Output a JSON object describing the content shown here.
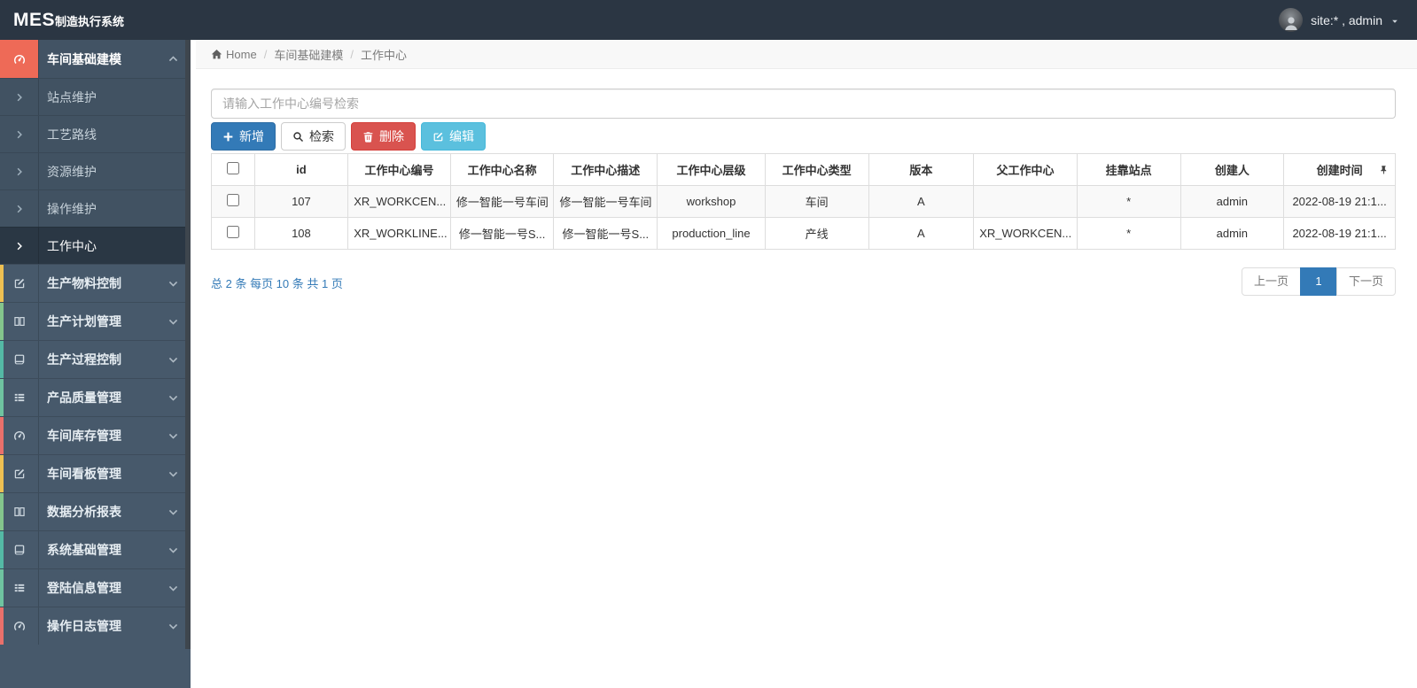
{
  "navbar": {
    "logo_bold": "MES",
    "logo_rest": "制造执行系统",
    "user_label": "site:* , admin",
    "avatar_icon": "user-icon",
    "caret_icon": "caret-down-icon"
  },
  "breadcrumb": {
    "home_icon": "home-icon",
    "items": [
      "Home",
      "车间基础建模",
      "工作中心"
    ]
  },
  "sidebar": {
    "expanded_group": {
      "label": "车间基础建模",
      "icon": "gauge-icon",
      "icon_bg": "#ee6a57",
      "chevron": "angle-up-icon"
    },
    "submenu": [
      {
        "label": "站点维护",
        "active": false
      },
      {
        "label": "工艺路线",
        "active": false
      },
      {
        "label": "资源维护",
        "active": false
      },
      {
        "label": "操作维护",
        "active": false
      },
      {
        "label": "工作中心",
        "active": true
      }
    ],
    "groups": [
      {
        "label": "生产物料控制",
        "icon": "pencil-square-icon",
        "accent": "#eec052"
      },
      {
        "label": "生产计划管理",
        "icon": "columns-icon",
        "accent": "#84c58c"
      },
      {
        "label": "生产过程控制",
        "icon": "book-icon",
        "accent": "#54b9a5"
      },
      {
        "label": "产品质量管理",
        "icon": "th-list-icon",
        "accent": "#6fc3a0"
      },
      {
        "label": "车间库存管理",
        "icon": "gauge-icon",
        "accent": "#e9706b"
      },
      {
        "label": "车间看板管理",
        "icon": "pencil-square-icon",
        "accent": "#eec052"
      },
      {
        "label": "数据分析报表",
        "icon": "columns-icon",
        "accent": "#84c58c"
      },
      {
        "label": "系统基础管理",
        "icon": "book-icon",
        "accent": "#54b9a5"
      },
      {
        "label": "登陆信息管理",
        "icon": "th-list-icon",
        "accent": "#6fc3a0"
      },
      {
        "label": "操作日志管理",
        "icon": "gauge-icon",
        "accent": "#e9706b"
      }
    ]
  },
  "toolbar": {
    "search_placeholder": "请输入工作中心编号检索",
    "search_value": "",
    "buttons": [
      {
        "label": "新增",
        "icon": "plus-icon",
        "style": "primary"
      },
      {
        "label": "检索",
        "icon": "search-icon",
        "style": "default"
      },
      {
        "label": "删除",
        "icon": "trash-icon",
        "style": "danger"
      },
      {
        "label": "编辑",
        "icon": "edit-icon",
        "style": "info"
      }
    ]
  },
  "table": {
    "pin_icon": "pin-icon",
    "columns": [
      "id",
      "工作中心编号",
      "工作中心名称",
      "工作中心描述",
      "工作中心层级",
      "工作中心类型",
      "版本",
      "父工作中心",
      "挂靠站点",
      "创建人",
      "创建时间"
    ],
    "rows": [
      [
        "107",
        "XR_WORKCEN...",
        "修一智能一号车间",
        "修一智能一号车间",
        "workshop",
        "车间",
        "A",
        "",
        "*",
        "admin",
        "2022-08-19 21:1..."
      ],
      [
        "108",
        "XR_WORKLINE...",
        "修一智能一号S...",
        "修一智能一号S...",
        "production_line",
        "产线",
        "A",
        "XR_WORKCEN...",
        "*",
        "admin",
        "2022-08-19 21:1..."
      ]
    ]
  },
  "pagination": {
    "summary": "总 2 条 每页 10 条 共 1 页",
    "prev_label": "上一页",
    "current_page": "1",
    "next_label": "下一页"
  },
  "colors": {
    "primary": "#337ab7",
    "danger": "#d9534f",
    "info": "#5bc0de",
    "navbar_bg": "#2b3643",
    "sidebar_bg": "#47596b",
    "sidebar_active_bg": "#2a3744",
    "expanded_icon_bg": "#ee6a57"
  }
}
